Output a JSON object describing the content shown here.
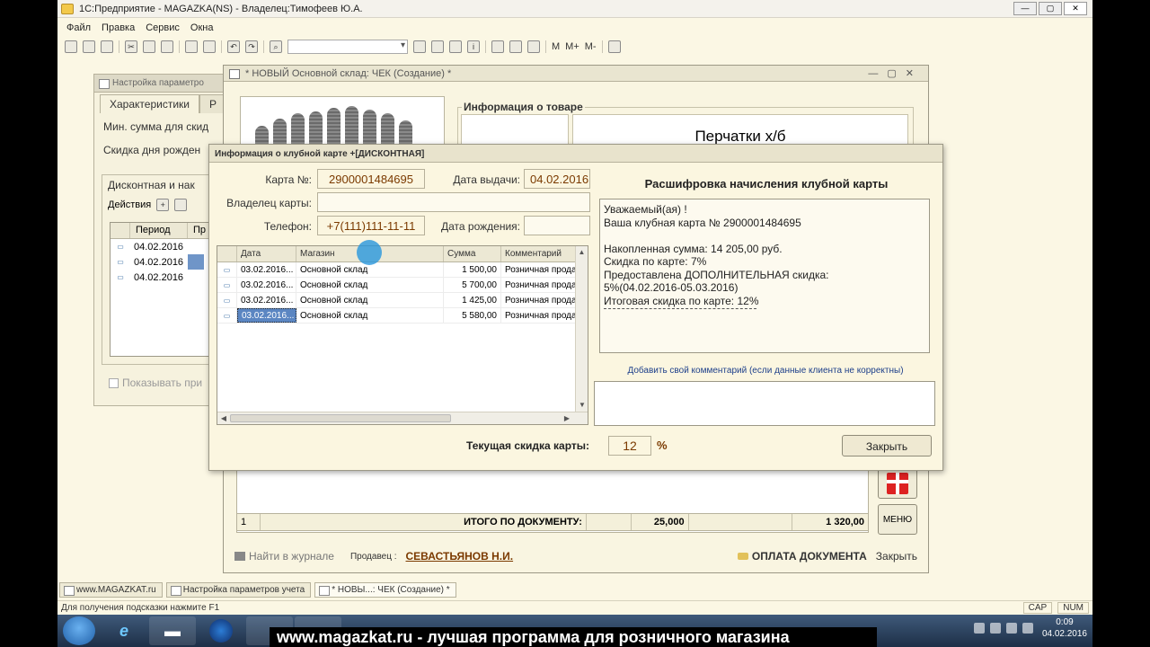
{
  "app": {
    "title": "1С:Предприятие - MAGAZKA(NS) - Владелец:Тимофеев Ю.А.",
    "menu": [
      "Файл",
      "Правка",
      "Сервис",
      "Окна"
    ],
    "toolbar_text": [
      "M",
      "M+",
      "M-"
    ]
  },
  "settings_window": {
    "title": "Настройка параметро",
    "tabs": [
      "Характеристики",
      "Р"
    ],
    "min_sum_label": "Мин. сумма для скид",
    "birthday_label": "Скидка дня рожден",
    "group_title": "Дисконтная и нак",
    "actions_label": "Действия",
    "grid_headers": [
      "Период",
      "Пр"
    ],
    "grid_rows": [
      "04.02.2016",
      "04.02.2016",
      "04.02.2016"
    ],
    "show_label": "Показывать при"
  },
  "check_window": {
    "title": "* НОВЫЙ Основной склад: ЧЕК (Создание) *",
    "info_legend": "Информация о товаре",
    "product_name": "Перчатки х/б",
    "total_row": {
      "num": "1",
      "label": "ИТОГО ПО ДОКУМЕНТУ:",
      "qty": "25,000",
      "sum": "1 320,00"
    },
    "menu_button": "МЕНЮ",
    "find_label": "Найти в журнале",
    "seller_label": "Продавец :",
    "seller_name": "СЕВАСТЬЯНОВ  Н.И.",
    "pay_label": "ОПЛАТА ДОКУМЕНТА",
    "close_label": "Закрыть"
  },
  "dialog": {
    "title": "Информация о клубной карте +[ДИСКОНТНАЯ]",
    "card_label": "Карта №:",
    "card_value": "2900001484695",
    "issue_label": "Дата выдачи:",
    "issue_value": "04.02.2016",
    "owner_label": "Владелец карты:",
    "owner_value": "",
    "phone_label": "Телефон:",
    "phone_value": "+7(111)111-11-11",
    "birth_label": "Дата рождения:",
    "birth_value": "",
    "grid_headers": [
      "Дата",
      "Магазин",
      "Сумма",
      "Комментарий"
    ],
    "grid_rows": [
      {
        "date": "03.02.2016...",
        "store": "Основной склад",
        "sum": "1 500,00",
        "comment": "Розничная прода"
      },
      {
        "date": "03.02.2016...",
        "store": "Основной склад",
        "sum": "5 700,00",
        "comment": "Розничная прода"
      },
      {
        "date": "03.02.2016...",
        "store": "Основной склад",
        "sum": "1 425,00",
        "comment": "Розничная прода"
      },
      {
        "date": "03.02.2016...",
        "store": "Основной склад",
        "sum": "5 580,00",
        "comment": "Розничная прода"
      }
    ],
    "decode_title": "Расшифровка начисления клубной карты",
    "decode_lines": [
      "Уважаемый(ая) !",
      "Ваша клубная карта № 2900001484695",
      "",
      "Накопленная сумма: 14 205,00 руб.",
      "Скидка по карте: 7%",
      "Предоставлена ДОПОЛНИТЕЛЬНАЯ скидка:",
      "5%(04.02.2016-05.03.2016)",
      "Итоговая скидка по карте: 12%"
    ],
    "comment_label": "Добавить свой комментарий (если данные клиента не корректны)",
    "discount_label": "Текущая скидка карты:",
    "discount_value": "12",
    "discount_unit": "%",
    "close_button": "Закрыть"
  },
  "window_tabs": [
    "www.MAGAZKAT.ru",
    "Настройка параметров учета",
    "* НОВЫ...: ЧЕК (Создание) *"
  ],
  "status": {
    "hint": "Для получения подсказки нажмите F1",
    "indicators": [
      "CAP",
      "NUM"
    ]
  },
  "os": {
    "promo": "www.magazkat.ru - лучшая программа для розничного магазина",
    "time": "0:09",
    "date": "04.02.2016"
  },
  "colors": {
    "background": "#fbf7e4",
    "field_text": "#7b3a00",
    "selection": "#5b86c2",
    "cursor": "#2896dc"
  }
}
